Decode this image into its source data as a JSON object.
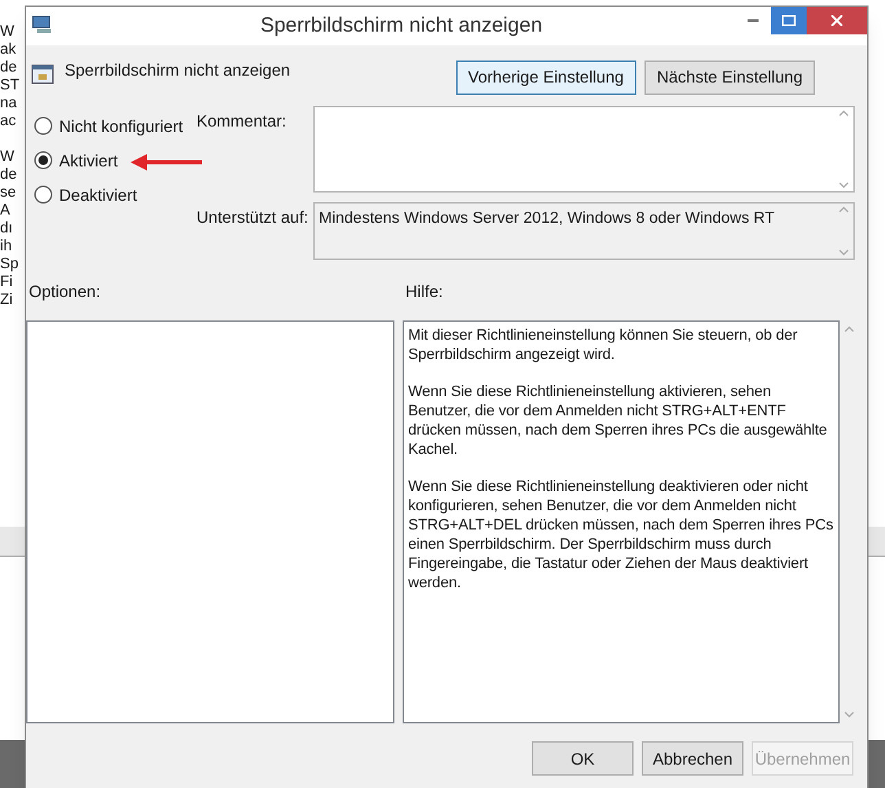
{
  "background_window": {
    "fragment_groups": [
      [
        "W",
        "ak",
        "de",
        "ST",
        "na",
        "ac"
      ],
      [
        "W",
        "de",
        "se",
        "A",
        "dı",
        "ih",
        "Sp",
        "Fi",
        "Zi"
      ]
    ]
  },
  "window": {
    "title": "Sperrbildschirm nicht anzeigen"
  },
  "header": {
    "title": "Sperrbildschirm nicht anzeigen"
  },
  "nav_buttons": [
    {
      "label": "Vorherige Einstellung",
      "selected": true
    },
    {
      "label": "Nächste Einstellung",
      "selected": false
    }
  ],
  "options": [
    {
      "label": "Nicht konfiguriert",
      "selected": false
    },
    {
      "label": "Aktiviert",
      "selected": true
    },
    {
      "label": "Deaktiviert",
      "selected": false
    }
  ],
  "comment": {
    "label": "Kommentar:"
  },
  "supported": {
    "label": "Unterstützt auf:",
    "value": "Mindestens Windows Server 2012, Windows 8 oder Windows RT"
  },
  "options_label": "Optionen:",
  "help_label": "Hilfe:",
  "help_paragraphs": [
    "Mit dieser Richtlinieneinstellung können Sie steuern, ob der Sperrbildschirm angezeigt wird.",
    "Wenn Sie diese Richtlinieneinstellung aktivieren, sehen Benutzer, die vor dem Anmelden nicht STRG+ALT+ENTF drücken müssen, nach dem Sperren ihres PCs die ausgewählte Kachel.",
    "Wenn Sie diese Richtlinieneinstellung deaktivieren oder nicht konfigurieren, sehen Benutzer, die vor dem Anmelden nicht STRG+ALT+DEL drücken müssen, nach dem Sperren ihres PCs einen Sperrbildschirm. Der Sperrbildschirm muss durch Fingereingabe, die Tastatur oder Ziehen der Maus deaktiviert werden."
  ],
  "footer_buttons": [
    {
      "label": "OK",
      "disabled": false
    },
    {
      "label": "Abbrechen",
      "disabled": false
    },
    {
      "label": "Übernehmen",
      "disabled": true
    }
  ]
}
